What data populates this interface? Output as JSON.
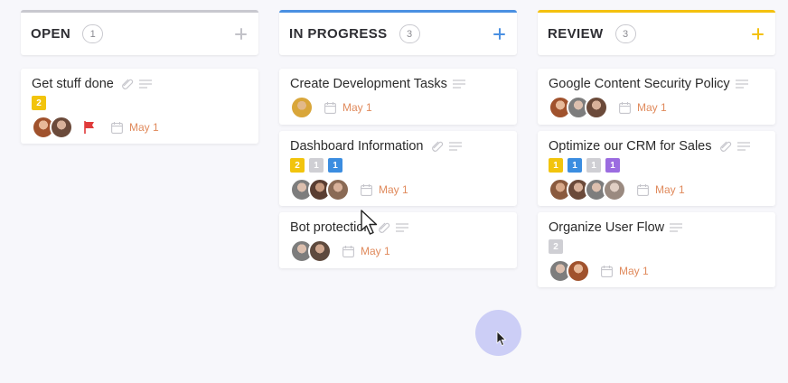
{
  "columns": [
    {
      "title": "OPEN",
      "count": "1",
      "accent": "#c8c8cf",
      "cards": [
        {
          "title": "Get stuff done",
          "attachment": true,
          "description": true,
          "tags": [
            {
              "label": "2",
              "color": "#f2c40d"
            }
          ],
          "avatars": [
            "#a0522d",
            "#6b4a3a"
          ],
          "flag": true,
          "date": "May 1"
        }
      ]
    },
    {
      "title": "IN PROGRESS",
      "count": "3",
      "accent": "#4a90e2",
      "cards": [
        {
          "title": "Create Development Tasks",
          "attachment": false,
          "description": true,
          "tags": [],
          "avatars": [
            "#d9a63a"
          ],
          "flag": false,
          "date": "May 1"
        },
        {
          "title": "Dashboard Information",
          "attachment": true,
          "description": true,
          "tags": [
            {
              "label": "2",
              "color": "#f2c40d"
            },
            {
              "label": "1",
              "color": "#cfcfd4"
            },
            {
              "label": "1",
              "color": "#3b8de0"
            }
          ],
          "avatars": [
            "#7d7d7d",
            "#5a3e32",
            "#8a6a55"
          ],
          "flag": false,
          "date": "May 1"
        },
        {
          "title": "Bot protection",
          "attachment": true,
          "description": true,
          "tags": [],
          "avatars": [
            "#7d7d7d",
            "#5e4a3e"
          ],
          "flag": false,
          "date": "May 1"
        }
      ]
    },
    {
      "title": "REVIEW",
      "count": "3",
      "accent": "#f4c10e",
      "cards": [
        {
          "title": "Google Content Security Policy",
          "attachment": false,
          "description": true,
          "tags": [],
          "avatars": [
            "#a0522d",
            "#7d7d7d",
            "#6b4a3a"
          ],
          "flag": false,
          "date": "May 1"
        },
        {
          "title": "Optimize our CRM for Sales",
          "attachment": true,
          "description": true,
          "tags": [
            {
              "label": "1",
              "color": "#f2c40d"
            },
            {
              "label": "1",
              "color": "#3b8de0"
            },
            {
              "label": "1",
              "color": "#cfcfd4"
            },
            {
              "label": "1",
              "color": "#9b6ce0"
            }
          ],
          "avatars": [
            "#8a5a3e",
            "#6b4a3a",
            "#7d7d7d",
            "#9a8a80"
          ],
          "flag": false,
          "date": "May 1"
        },
        {
          "title": "Organize User Flow",
          "attachment": false,
          "description": true,
          "tags": [
            {
              "label": "2",
              "color": "#cfcfd4"
            }
          ],
          "avatars": [
            "#7d7d7d",
            "#a0522d"
          ],
          "flag": false,
          "date": "May 1"
        }
      ]
    }
  ],
  "icons": {
    "attachment": "paperclip-icon",
    "description": "description-lines-icon",
    "flag": "flag-icon",
    "date": "calendar-icon",
    "add": "plus-icon",
    "cursor": "mouse-cursor-icon"
  }
}
